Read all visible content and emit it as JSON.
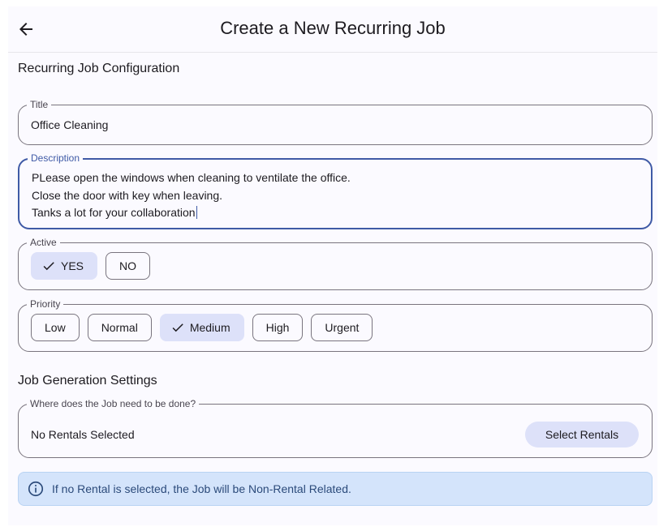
{
  "appbar": {
    "title": "Create a New Recurring Job",
    "back_icon": "arrow-back-icon"
  },
  "config_section": {
    "title": "Recurring Job Configuration"
  },
  "title_field": {
    "label": "Title",
    "value": "Office Cleaning"
  },
  "description_field": {
    "label": "Description",
    "lines": [
      "PLease open the windows when cleaning to ventilate the office.",
      "Close the door with key when leaving.",
      "Tanks a lot for your collaboration"
    ]
  },
  "active_field": {
    "label": "Active",
    "options": [
      "YES",
      "NO"
    ],
    "selected": "YES"
  },
  "priority_field": {
    "label": "Priority",
    "options": [
      "Low",
      "Normal",
      "Medium",
      "High",
      "Urgent"
    ],
    "selected": "Medium"
  },
  "generation_section": {
    "title": "Job Generation Settings"
  },
  "rentals_field": {
    "label": "Where does the Job need to be done?",
    "value": "No Rentals Selected",
    "button_label": "Select Rentals"
  },
  "info_banner": {
    "text": "If no Rental is selected, the Job will be Non-Rental Related.",
    "icon": "info-icon"
  },
  "colors": {
    "accent": "#3f5aa6",
    "chip_selected": "#dde1f9",
    "info_background": "#d4e4fb",
    "outline": "#79747e"
  }
}
